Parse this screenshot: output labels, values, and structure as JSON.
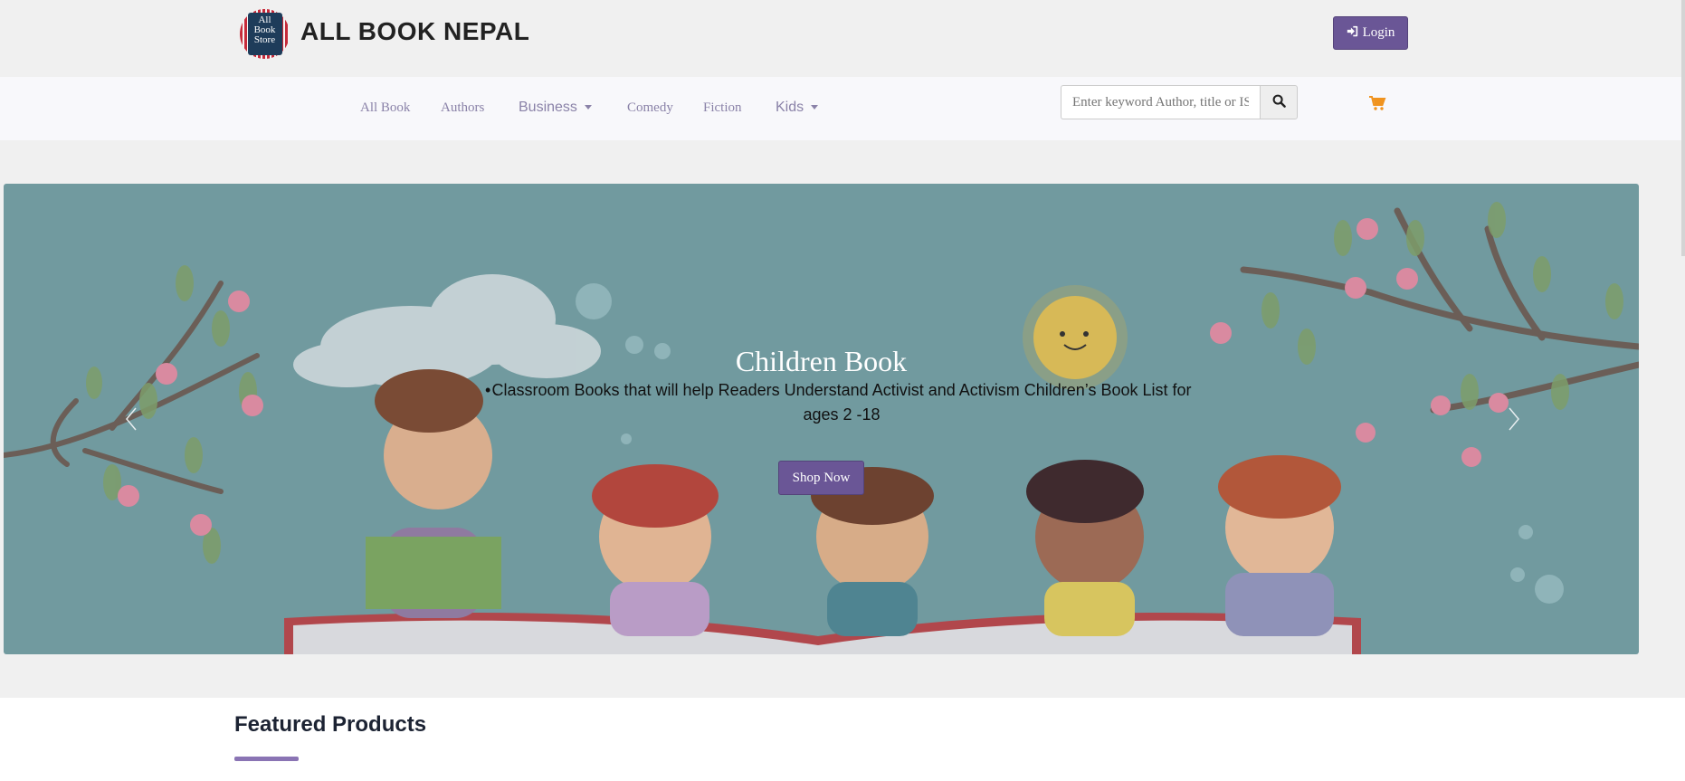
{
  "header": {
    "brand": "ALL BOOK NEPAL",
    "logo_text": [
      "All",
      "Book",
      "Store"
    ],
    "login_label": "Login",
    "login_icon": "sign-in-icon"
  },
  "nav": {
    "items": [
      {
        "label": "All Book",
        "dropdown": false
      },
      {
        "label": "Authors",
        "dropdown": false
      },
      {
        "label": "Business",
        "dropdown": true
      },
      {
        "label": "Comedy",
        "dropdown": false
      },
      {
        "label": "Fiction",
        "dropdown": false
      },
      {
        "label": "Kids",
        "dropdown": true
      }
    ],
    "search_placeholder": "Enter keyword Author, title or ISBN",
    "search_icon": "search-icon",
    "cart_icon": "cart-icon"
  },
  "hero": {
    "title": "Children Book",
    "bullet": "Classroom Books that will help Readers Understand Activist and Activism Children’s Book List for ages 2 -18",
    "cta_label": "Shop Now"
  },
  "featured": {
    "title": "Featured Products"
  },
  "colors": {
    "accent": "#6a5696",
    "nav_text": "#8a82a8",
    "cart": "#f0931e",
    "hero_bg": "#719a9f"
  }
}
